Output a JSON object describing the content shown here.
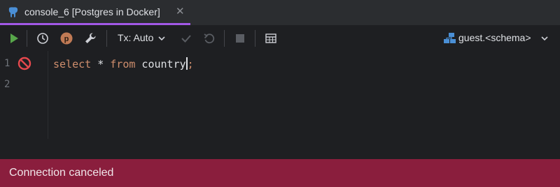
{
  "tab": {
    "title": "console_6 [Postgres in Docker]",
    "close_glyph": "✕",
    "icon": "postgres-elephant-icon",
    "accent_color": "#a259e6"
  },
  "toolbar": {
    "run_icon": "run-icon",
    "history_icon": "history-icon",
    "profile_icon": "profile-icon",
    "settings_icon": "wrench-icon",
    "tx_label": "Tx: Auto",
    "commit_icon": "check-icon",
    "rollback_icon": "undo-icon",
    "stop_icon": "stop-icon",
    "table_icon": "table-icon",
    "schema_label": "guest.<schema>"
  },
  "editor": {
    "line_numbers": [
      "1",
      "2"
    ],
    "code": {
      "kw_select": "select",
      "star": " * ",
      "kw_from": "from",
      "table": " country",
      "semicolon": ";"
    },
    "gutter_icon": "error-stop-icon"
  },
  "status": {
    "message": "Connection canceled",
    "color": "#8a1e3d"
  }
}
